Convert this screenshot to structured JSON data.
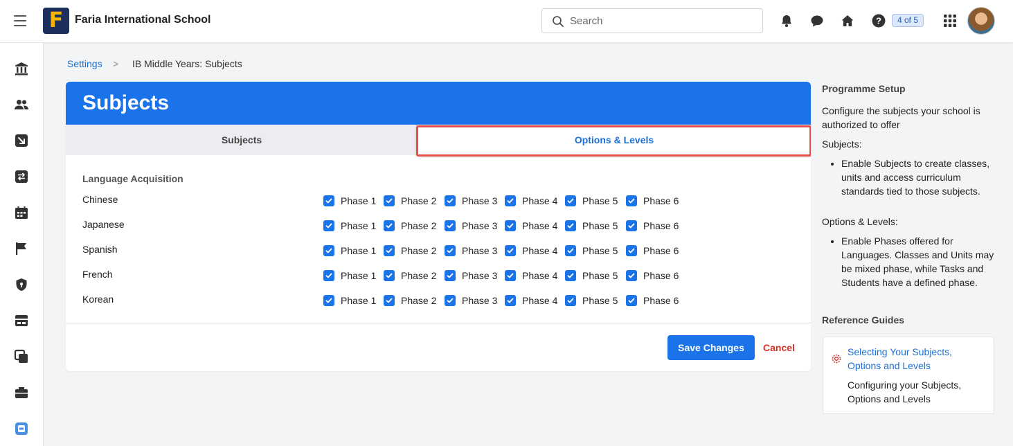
{
  "topbar": {
    "school_name": "Faria International School",
    "logo_letter": "F",
    "search_placeholder": "Search",
    "pager": "4 of 5",
    "icons": [
      "menu-icon",
      "bell-icon",
      "chat-icon",
      "home-icon",
      "help-icon",
      "apps-grid-icon",
      "user-avatar"
    ]
  },
  "sidebar": {
    "icons": [
      "institution-icon",
      "people-icon",
      "arrow-down-right-icon",
      "transfer-icon",
      "calendar-icon",
      "flag-icon",
      "shield-icon",
      "cards-icon",
      "copy-icon",
      "briefcase-icon",
      "app-badge-icon"
    ]
  },
  "breadcrumb": {
    "root": "Settings",
    "separator": ">",
    "current": "IB Middle Years: Subjects"
  },
  "card": {
    "title": "Subjects",
    "tabs": [
      {
        "label": "Subjects",
        "active": false
      },
      {
        "label": "Options & Levels",
        "active": true
      }
    ],
    "section_title": "Language Acquisition",
    "languages": [
      {
        "name": "Chinese",
        "phases": [
          "Phase 1",
          "Phase 2",
          "Phase 3",
          "Phase 4",
          "Phase 5",
          "Phase 6"
        ],
        "checked": [
          true,
          true,
          true,
          true,
          true,
          true
        ]
      },
      {
        "name": "Japanese",
        "phases": [
          "Phase 1",
          "Phase 2",
          "Phase 3",
          "Phase 4",
          "Phase 5",
          "Phase 6"
        ],
        "checked": [
          true,
          true,
          true,
          true,
          true,
          true
        ]
      },
      {
        "name": "Spanish",
        "phases": [
          "Phase 1",
          "Phase 2",
          "Phase 3",
          "Phase 4",
          "Phase 5",
          "Phase 6"
        ],
        "checked": [
          true,
          true,
          true,
          true,
          true,
          true
        ]
      },
      {
        "name": "French",
        "phases": [
          "Phase 1",
          "Phase 2",
          "Phase 3",
          "Phase 4",
          "Phase 5",
          "Phase 6"
        ],
        "checked": [
          true,
          true,
          true,
          true,
          true,
          true
        ]
      },
      {
        "name": "Korean",
        "phases": [
          "Phase 1",
          "Phase 2",
          "Phase 3",
          "Phase 4",
          "Phase 5",
          "Phase 6"
        ],
        "checked": [
          true,
          true,
          true,
          true,
          true,
          true
        ]
      }
    ],
    "save_label": "Save Changes",
    "cancel_label": "Cancel"
  },
  "right_panel": {
    "heading": "Programme Setup",
    "intro": "Configure the subjects your school is authorized to offer",
    "subjects_heading": "Subjects:",
    "subjects_bullet": "Enable Subjects to create classes, units and access curriculum standards tied to those subjects.",
    "options_heading": "Options & Levels:",
    "options_bullet": "Enable Phases offered for Languages. Classes and Units may be mixed phase, while Tasks and Students have a defined phase.",
    "reference_heading": "Reference Guides",
    "reference_link": "Selecting Your Subjects, Options and Levels",
    "reference_desc": "Configuring your Subjects, Options and Levels"
  },
  "colors": {
    "accent": "#1a73e8",
    "highlight": "#e0524a",
    "cancel": "#d6322a",
    "logo_bg": "#1d2f5c",
    "logo_letter": "#f5b400"
  }
}
